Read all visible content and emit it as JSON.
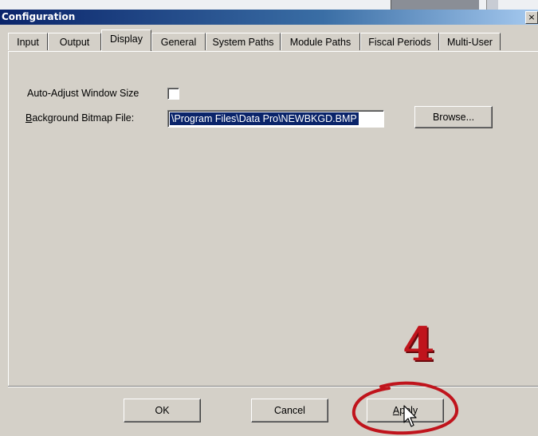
{
  "window": {
    "title": "Configuration",
    "close_glyph": "×"
  },
  "tabs": [
    {
      "label": "Input"
    },
    {
      "label": "Output"
    },
    {
      "label": "Display",
      "active": true
    },
    {
      "label": "General"
    },
    {
      "label": "System Paths"
    },
    {
      "label": "Module Paths"
    },
    {
      "label": "Fiscal Periods"
    },
    {
      "label": "Multi-User"
    }
  ],
  "display": {
    "auto_adjust_label": "Auto-Adjust Window Size",
    "auto_adjust_checked": false,
    "bg_bitmap_label": "Background Bitmap File:",
    "bg_bitmap_value": "\\Program Files\\Data Pro\\NEWBKGD.BMP",
    "browse_label": "Browse..."
  },
  "footer": {
    "ok_label": "OK",
    "cancel_label": "Cancel",
    "apply_label": "Apply"
  },
  "annotation": {
    "step_number": "4",
    "color": "#c0141c"
  }
}
